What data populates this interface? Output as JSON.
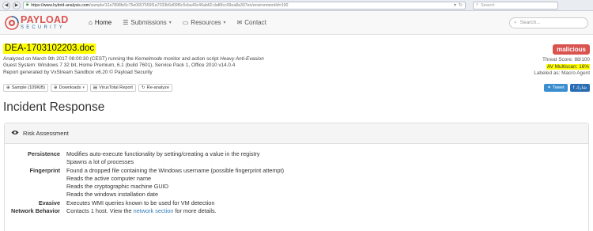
{
  "browser": {
    "url_host": "https://www.hybrid-analysis.com",
    "url_path": "/sample/12a7898fe5c75e0657559f1a7033b5d09f5c5cba49c46ab60.daf6fcc09ea8a307en/environmentId=100",
    "search_placeholder": "Search"
  },
  "navbar": {
    "logo_title": "PAYLOAD",
    "logo_subtitle": "SECURITY",
    "items": [
      {
        "label": "Home",
        "icon": "home-icon"
      },
      {
        "label": "Submissions",
        "icon": "list-icon"
      },
      {
        "label": "Resources",
        "icon": "folder-icon"
      },
      {
        "label": "Contact",
        "icon": "contact-icon"
      }
    ],
    "search_placeholder": "Search..."
  },
  "report": {
    "file_name": "DEA-1703102203.doc",
    "analyzed_prefix": "Analyzed on March 9th 2017 08:00:30 (CEST) running the ",
    "monitor_name": "Kernelmode",
    "analyzed_mid": " monitor and action script ",
    "action_script": "Heavy Anti-Evasion",
    "guest_system": "Guest System: Windows 7 32 bit, Home Premium, 6.1 (build 7601), Service Pack 1, Office 2010 v14.0.4",
    "generated_by": "Report generated by VxStream Sandbox v6.20 © Payload Security",
    "buttons": {
      "sample": "Sample (109KiB)",
      "downloads": "Downloads",
      "virustotal": "VirusTotal Report",
      "reanalyze": "Re-analyze"
    },
    "verdict": "malicious",
    "threat_score": "Threat Score: 88/100",
    "av_multiscan": "AV Multiscan: 16%",
    "labeled_as": "Labeled as: Macro Agent",
    "tweet": "Tweet",
    "share": "شارك"
  },
  "incident": {
    "title": "Incident Response",
    "panel_title": "Risk Assessment",
    "rows": [
      {
        "label": "Persistence",
        "value": "Modifies auto-execute functionality by setting/creating a value in the registry"
      },
      {
        "label": "",
        "value": "Spawns a lot of processes"
      },
      {
        "label": "Fingerprint",
        "value": "Found a dropped file containing the Windows username (possible fingerprint attempt)"
      },
      {
        "label": "",
        "value": "Reads the active computer name"
      },
      {
        "label": "",
        "value": "Reads the cryptographic machine GUID"
      },
      {
        "label": "",
        "value": "Reads the windows installation date"
      },
      {
        "label": "Evasive",
        "value": "Executes WMI queries known to be used for VM detection"
      }
    ],
    "network": {
      "label": "Network Behavior",
      "prefix": "Contacts 1 host. View the ",
      "link": "network section",
      "suffix": " for more details."
    }
  },
  "colors": {
    "accent_red": "#d9534f",
    "highlight": "#ffff00",
    "link": "#337ab7"
  }
}
